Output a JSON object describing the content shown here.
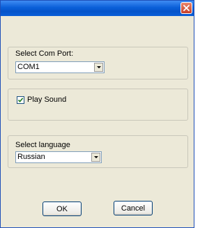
{
  "dialog": {
    "title": "",
    "close_icon": "close-x-icon"
  },
  "com_port": {
    "label": "Select Com Port:",
    "selected": "COM1"
  },
  "sound": {
    "label": "Play Sound",
    "checked": true
  },
  "language": {
    "label": "Select  language",
    "selected": "Russian"
  },
  "buttons": {
    "ok": "OK",
    "cancel": "Cancel"
  },
  "colors": {
    "titlebar": "#0a5fd8",
    "close_button": "#c7402a",
    "dialog_bg": "#ece9d8"
  }
}
